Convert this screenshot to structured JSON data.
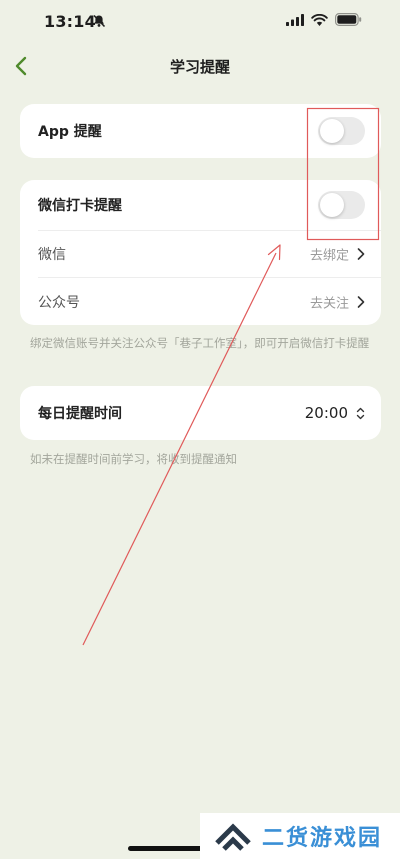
{
  "status_bar": {
    "time": "13:14"
  },
  "nav": {
    "title": "学习提醒"
  },
  "app_reminder": {
    "label": "App 提醒",
    "enabled": false
  },
  "wechat_card": {
    "checkin_label": "微信打卡提醒",
    "checkin_enabled": false,
    "wechat_label": "微信",
    "wechat_action": "去绑定",
    "official_label": "公众号",
    "official_action": "去关注"
  },
  "wechat_hint": "绑定微信账号并关注公众号「巷子工作室」，即可开启微信打卡提醒",
  "daily_time": {
    "label": "每日提醒时间",
    "value": "20:00"
  },
  "time_hint": "如未在提醒时间前学习，将收到提醒通知",
  "watermark": {
    "text": "二货游戏园"
  },
  "colors": {
    "background": "#eef1e6",
    "accent_green": "#4f8a2b",
    "annotation_red": "#e05a5a",
    "watermark_blue": "#3a8fd6"
  }
}
